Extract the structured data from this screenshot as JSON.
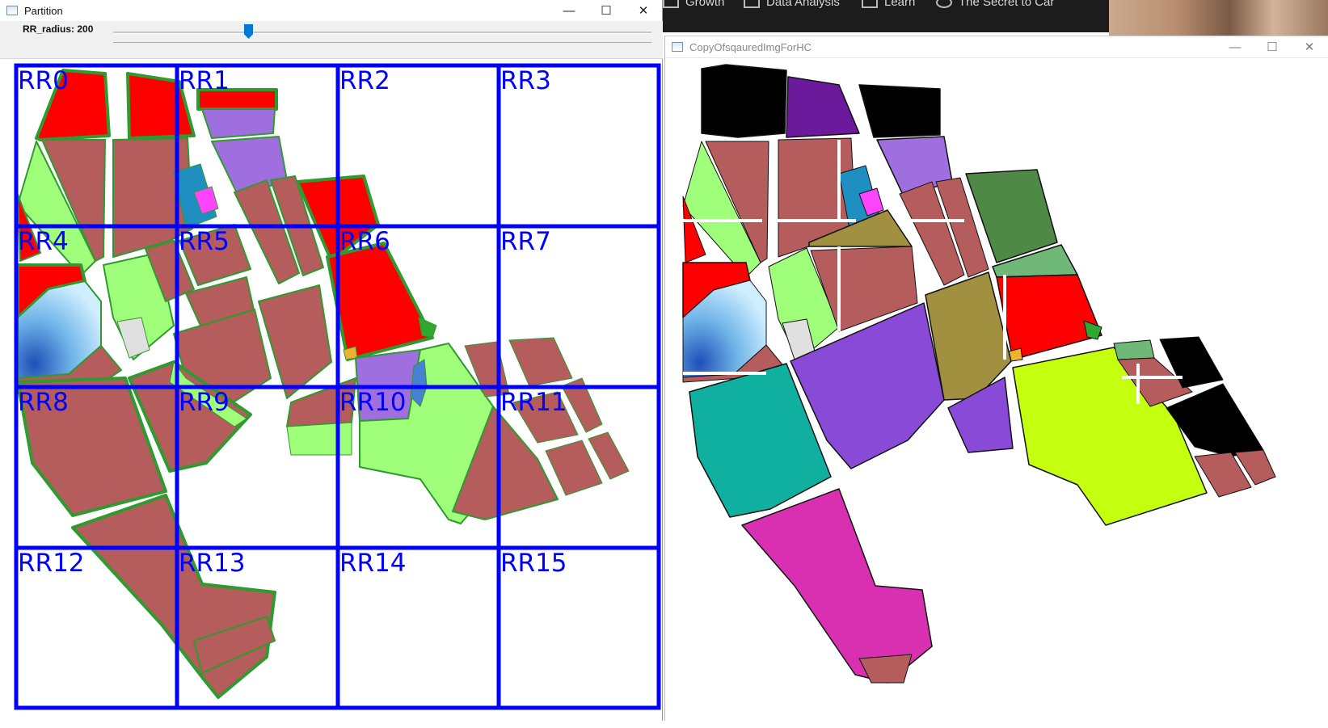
{
  "window1": {
    "title": "Partition",
    "controls": {
      "minimize": "—",
      "maximize": "☐",
      "close": "✕"
    },
    "trackbar": {
      "label": "RR_radius: 200",
      "value": 200
    }
  },
  "window2": {
    "title": "CopyOfsqauredImgForHC",
    "controls": {
      "minimize": "—",
      "maximize": "☐",
      "close": "✕"
    }
  },
  "taskbar": {
    "items": [
      {
        "label": "Growth"
      },
      {
        "label": "Data Analysis"
      },
      {
        "label": "Learn"
      },
      {
        "label": "The Secret to Car"
      }
    ]
  },
  "grid": {
    "rows": 4,
    "cols": 4,
    "line_color": "#0000ff",
    "labels": [
      "RR0",
      "RR1",
      "RR2",
      "RR3",
      "RR4",
      "RR5",
      "RR6",
      "RR7",
      "RR8",
      "RR9",
      "RR10",
      "RR11",
      "RR12",
      "RR13",
      "RR14",
      "RR15"
    ]
  },
  "colors": {
    "parcel": "#b55c5c",
    "red_zone": "#ff0000",
    "green_zone": "#a0ff7a",
    "purple_zone": "#9f6fe0",
    "edge": "#2f9a2f",
    "water": "#6fb4e8",
    "cluster_black": "#000000",
    "cluster_violet": "#6a1a9a",
    "cluster_forest": "#4e8a45",
    "cluster_olive": "#a09040",
    "cluster_lightgreen": "#70b878",
    "cluster_purple": "#8a4ad8",
    "cluster_teal": "#10b0a0",
    "cluster_lime": "#c4ff10",
    "cluster_magenta": "#d830b0"
  }
}
